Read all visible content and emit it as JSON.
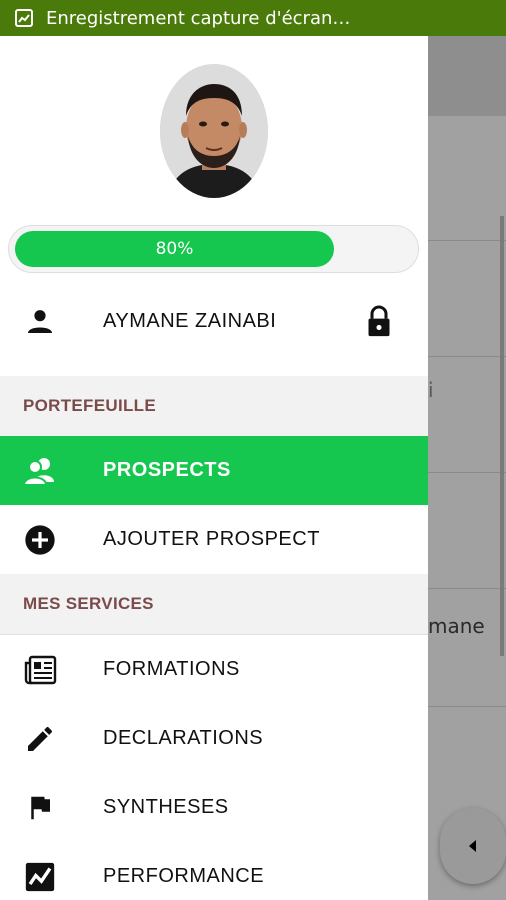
{
  "status_bar": {
    "text": "Enregistrement capture d'écran…",
    "icon": "screen-record-icon",
    "color": "#4a7a0a"
  },
  "profile": {
    "avatar_icon": "user-photo-avatar",
    "progress_value": 0.8,
    "progress_label": "80%",
    "progress_color": "#15c64f",
    "user_name": "AYMANE ZAINABI",
    "user_icon": "person-icon",
    "lock_icon": "lock-icon"
  },
  "sections": {
    "portefeuille": "PORTEFEUILLE",
    "mes_services": "MES SERVICES"
  },
  "menu": {
    "prospects": {
      "label": "PROSPECTS",
      "icon": "group-icon",
      "active": true
    },
    "ajouter_prospect": {
      "label": "AJOUTER PROSPECT",
      "icon": "add-circle-icon"
    },
    "formations": {
      "label": "FORMATIONS",
      "icon": "newspaper-icon"
    },
    "declarations": {
      "label": "DECLARATIONS",
      "icon": "pencil-icon"
    },
    "syntheses": {
      "label": "SYNTHESES",
      "icon": "flag-icon"
    },
    "performance": {
      "label": "PERFORMANCE",
      "icon": "chart-icon"
    }
  },
  "background": {
    "partial_text": "mane",
    "partial_char": "i"
  }
}
